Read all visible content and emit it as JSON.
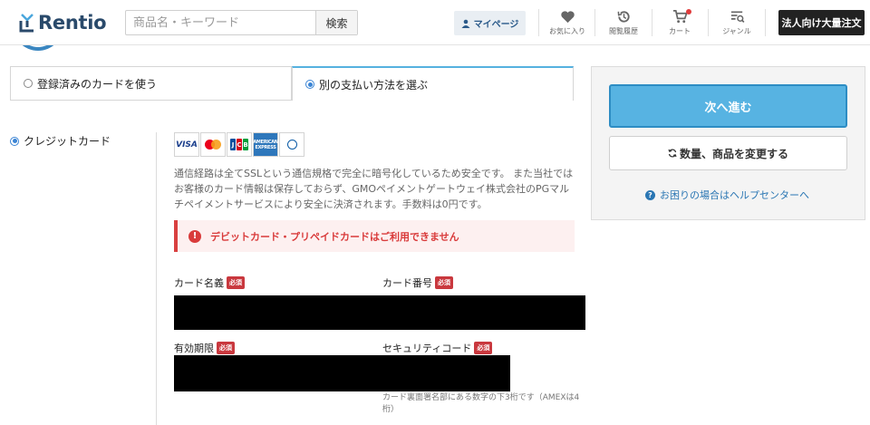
{
  "header": {
    "logo_text": "Rentio",
    "search_placeholder": "商品名・キーワード",
    "search_button": "検索",
    "mypage_label": "マイページ",
    "icons": [
      {
        "name": "heart-icon",
        "label": "お気に入り"
      },
      {
        "name": "history-icon",
        "label": "閲覧履歴"
      },
      {
        "name": "cart-icon",
        "label": "カート"
      },
      {
        "name": "genre-icon",
        "label": "ジャンル"
      }
    ],
    "business_button": "法人向け大量注文",
    "colors": {
      "brand": "#2a4a6b",
      "badge": "#e03c3c"
    }
  },
  "payment": {
    "tabs": [
      {
        "label": "登録済みのカードを使う",
        "selected": false
      },
      {
        "label": "別の支払い方法を選ぶ",
        "selected": true
      }
    ],
    "method": {
      "label": "クレジットカード",
      "selected": true
    },
    "card_brands": {
      "visa": "VISA",
      "jcb": [
        "J",
        "C",
        "B"
      ],
      "amex": "AMERICAN EXPRESS"
    },
    "description": "通信経路は全てSSLという通信規格で完全に暗号化しているため安全です。 また当社ではお客様のカード情報は保存しておらず、GMOペイメントゲートウェイ株式会社のPGマルチペイメントサービスにより安全に決済されます。手数料は0円です。",
    "alert": {
      "icon": "!",
      "text": "デビットカード・プリペイドカードはご利用できません",
      "color": "#d93b3b"
    },
    "fields": {
      "card_name": {
        "label": "カード名義",
        "required": "必須"
      },
      "card_number": {
        "label": "カード番号",
        "required": "必須"
      },
      "expiry": {
        "label": "有効期限",
        "required": "必須"
      },
      "security_code": {
        "label": "セキュリティコード",
        "required": "必須"
      }
    },
    "security_hint": "カード裏面署名部にある数字の下3桁です（AMEXは4桁）"
  },
  "side": {
    "next_button": "次へ進む",
    "change_button": "数量、商品を変更する",
    "help_icon": "?",
    "help_link": "お困りの場合はヘルプセンターへ",
    "colors": {
      "primary": "#57b3e2",
      "link": "#2a76b3"
    }
  }
}
